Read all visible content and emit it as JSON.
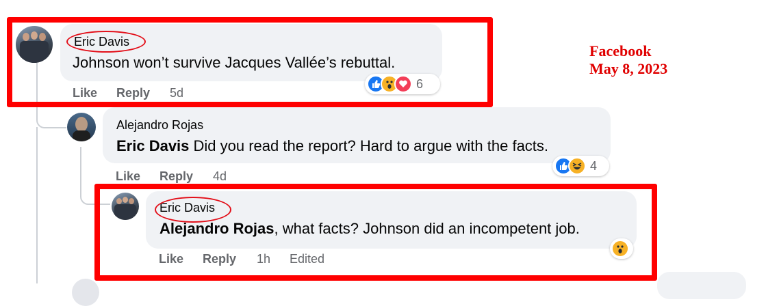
{
  "source": {
    "site": "Facebook",
    "date": "May 8, 2023"
  },
  "comments": [
    {
      "author": "Eric Davis",
      "mention": "",
      "text": "Johnson won’t survive Jacques Vallée’s rebuttal.",
      "like_label": "Like",
      "reply_label": "Reply",
      "time": "5d",
      "edited": "",
      "reactions": [
        "like",
        "wow",
        "love"
      ],
      "reaction_count": "6"
    },
    {
      "author": "Alejandro Rojas",
      "mention": "Eric Davis",
      "text": " Did you read the report? Hard to argue with the facts.",
      "like_label": "Like",
      "reply_label": "Reply",
      "time": "4d",
      "edited": "",
      "reactions": [
        "like",
        "haha"
      ],
      "reaction_count": "4"
    },
    {
      "author": "Eric Davis",
      "mention": "Alejandro Rojas",
      "text": ", what facts? Johnson did an incompetent job.",
      "like_label": "Like",
      "reply_label": "Reply",
      "time": "1h",
      "edited": "Edited",
      "reactions": [
        "wow"
      ],
      "reaction_count": ""
    }
  ],
  "colors": {
    "highlight_red": "#ff0000",
    "bubble_bg": "#f0f2f5",
    "meta_gray": "#65676b",
    "like_blue": "#1877f2",
    "love_red": "#f33e58",
    "emoji_yellow": "#f7b125"
  }
}
